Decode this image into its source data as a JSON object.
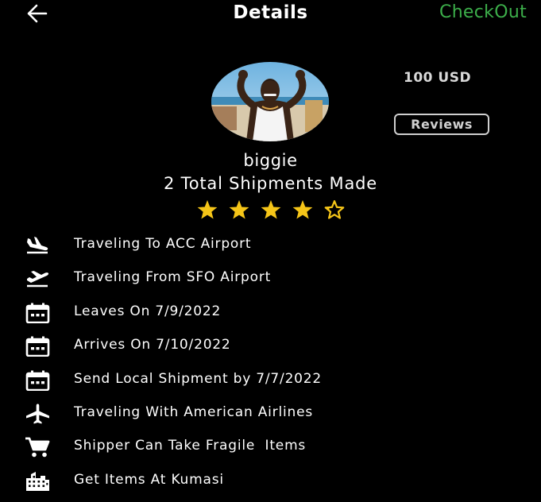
{
  "header": {
    "back_icon": "arrow-left-icon",
    "title": "Details",
    "checkout_label": "CheckOut",
    "checkout_color": "#3cae4a"
  },
  "profile": {
    "price": "100 USD",
    "reviews_label": "Reviews",
    "username": "biggie",
    "shipments_text": "2 Total Shipments Made",
    "rating": 4.5,
    "rating_max": 5,
    "star_color": "#f5c518"
  },
  "details": [
    {
      "icon": "flight-land-icon",
      "text": "Traveling To ACC Airport"
    },
    {
      "icon": "flight-takeoff-icon",
      "text": "Traveling From SFO Airport"
    },
    {
      "icon": "calendar-icon",
      "text": "Leaves On 7/9/2022"
    },
    {
      "icon": "calendar-icon",
      "text": "Arrives On 7/10/2022"
    },
    {
      "icon": "calendar-icon",
      "text": "Send Local Shipment by 7/7/2022"
    },
    {
      "icon": "airplane-icon",
      "text": "Traveling With American Airlines"
    },
    {
      "icon": "shopping-cart-icon",
      "text": "Shipper Can Take Fragile  Items"
    },
    {
      "icon": "city-icon",
      "text": "Get Items At Kumasi"
    }
  ]
}
